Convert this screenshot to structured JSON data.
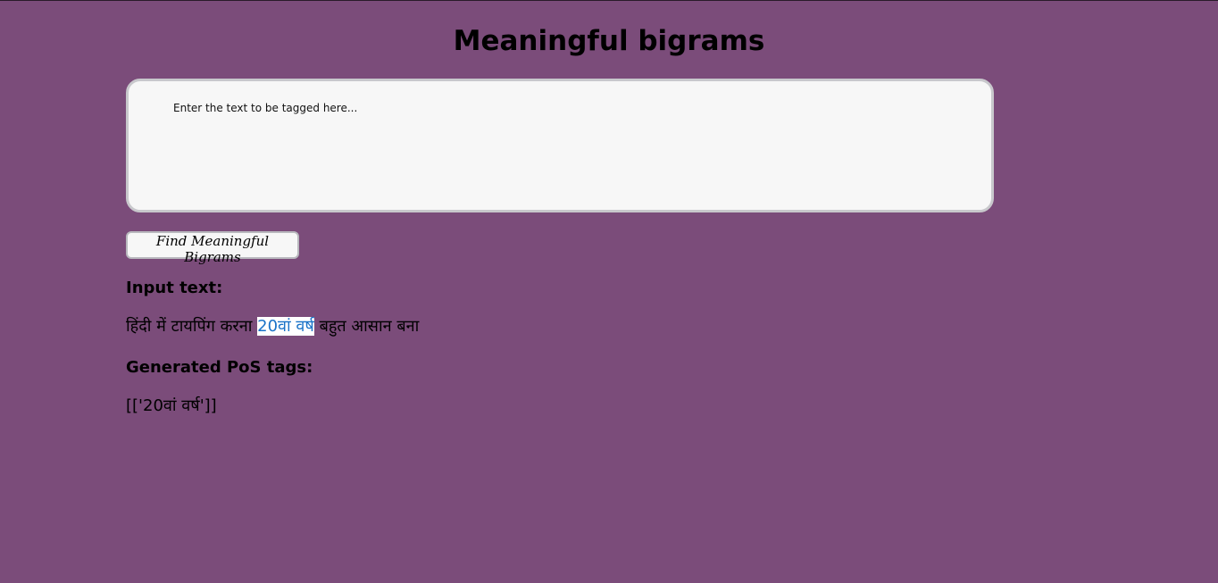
{
  "page": {
    "title": "Meaningful bigrams"
  },
  "input": {
    "placeholder": "Enter the text to be tagged here...",
    "value": ""
  },
  "button": {
    "label": "Find Meaningful Bigrams"
  },
  "result": {
    "input_label": "Input text:",
    "input_before": "हिंदी में टायपिंग करना ",
    "input_highlight": "20वां वर्ष",
    "input_after": " बहुत आसान बना",
    "tags_label": "Generated PoS tags:",
    "tags_value": "[['20वां वर्ष']]"
  },
  "colors": {
    "background": "#7b4c7a",
    "highlight_text": "#1a73c8",
    "highlight_bg": "#ffffff"
  }
}
